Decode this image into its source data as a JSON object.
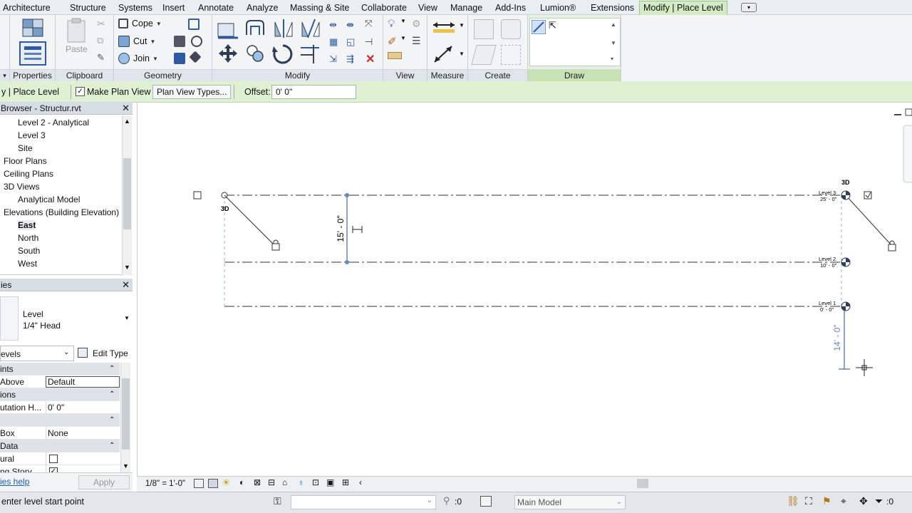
{
  "tabs": [
    "Architecture",
    "Structure",
    "Systems",
    "Insert",
    "Annotate",
    "Analyze",
    "Massing & Site",
    "Collaborate",
    "View",
    "Manage",
    "Add-Ins",
    "Lumion®",
    "Extensions",
    "Modify | Place Level"
  ],
  "ribbon": {
    "panels": {
      "properties": "Properties",
      "clipboard": "Clipboard",
      "geometry": "Geometry",
      "modify": "Modify",
      "view": "View",
      "measure": "Measure",
      "create": "Create",
      "draw": "Draw"
    },
    "clipboard_paste": "Paste",
    "geometry_cope": "Cope",
    "geometry_cut": "Cut",
    "geometry_join": "Join"
  },
  "options_bar": {
    "context": "y | Place Level",
    "make_plan_view": "Make Plan View",
    "plan_view_types": "Plan View Types...",
    "offset_label": "Offset:",
    "offset_value": "0'  0\""
  },
  "project_browser": {
    "title": "Browser - Structur.rvt",
    "items": [
      {
        "label": "Level 2 - Analytical",
        "indent": 1
      },
      {
        "label": "Level 3",
        "indent": 1
      },
      {
        "label": "Site",
        "indent": 1
      },
      {
        "label": "Floor Plans",
        "indent": 0
      },
      {
        "label": "Ceiling Plans",
        "indent": 0
      },
      {
        "label": "3D Views",
        "indent": 0
      },
      {
        "label": "Analytical Model",
        "indent": 1
      },
      {
        "label": "Elevations (Building Elevation)",
        "indent": 0
      },
      {
        "label": "East",
        "indent": 1,
        "bold": true
      },
      {
        "label": "North",
        "indent": 1
      },
      {
        "label": "South",
        "indent": 1
      },
      {
        "label": "West",
        "indent": 1
      }
    ]
  },
  "properties": {
    "title": "ies",
    "type_name": "Level",
    "type_sub": "1/4\" Head",
    "selector": "evels",
    "edit_type": "Edit Type",
    "rows": [
      {
        "label": "ints",
        "category": true
      },
      {
        "label": "Above",
        "value": "Default",
        "boxed": true
      },
      {
        "label": "ions",
        "category": true
      },
      {
        "label": "utation H...",
        "value": "0'  0\""
      },
      {
        "label": "",
        "category": true
      },
      {
        "label": "Box",
        "value": "None"
      },
      {
        "label": "Data",
        "category": true
      },
      {
        "label": "ural",
        "check": false
      },
      {
        "label": "ng Story",
        "check": true
      }
    ],
    "help": "ies help",
    "apply": "Apply"
  },
  "canvas": {
    "labels_3d": [
      "3D",
      "3D"
    ],
    "dim_upper": "15' - 0\"",
    "dim_lower": "14' - 0\"",
    "levels": [
      {
        "name": "Level 3",
        "elev": "25' - 0\""
      },
      {
        "name": "Level 2",
        "elev": "10' - 0\""
      },
      {
        "name": "Level 1",
        "elev": "0' - 0\""
      }
    ]
  },
  "view_bar": {
    "scale": "1/8\" = 1'-0\""
  },
  "status": {
    "prompt": "enter level start point",
    "count_a": ":0",
    "model": "Main Model",
    "count_b": ":0"
  },
  "colors": {
    "ribbon_active": "#d3ecc4",
    "options_bar": "#dff1d2",
    "dim_blue": "#6a86b8"
  }
}
